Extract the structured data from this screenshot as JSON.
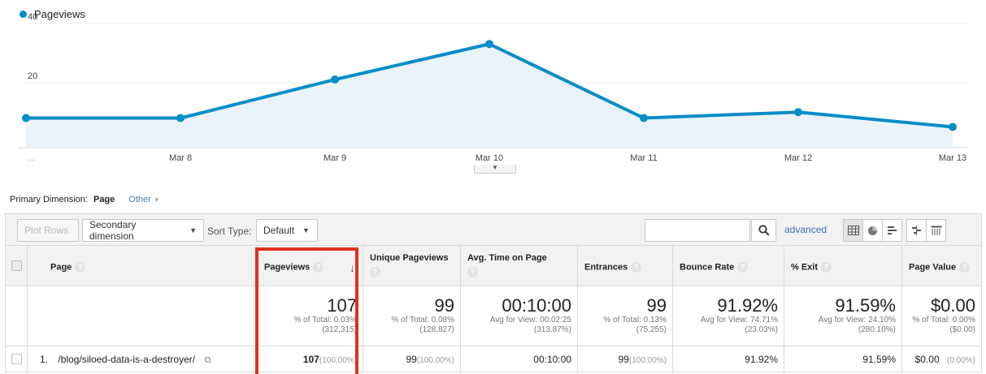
{
  "chart": {
    "legend": "Pageviews",
    "accent_color": "#058dc7",
    "toggle_icon": "chevron-down-icon"
  },
  "chart_data": {
    "type": "area",
    "title": "",
    "series": [
      {
        "name": "Pageviews",
        "values": [
          10,
          10,
          23,
          35,
          10,
          12,
          7
        ]
      }
    ],
    "x": [
      "…",
      "Mar 8",
      "Mar 9",
      "Mar 10",
      "Mar 11",
      "Mar 12",
      "Mar 13"
    ],
    "yticks": [
      20,
      40
    ],
    "ylim": [
      0,
      40
    ],
    "grid": true,
    "legend_position": "top-left"
  },
  "primary_dimension": {
    "label": "Primary Dimension:",
    "active": "Page",
    "other": "Other"
  },
  "toolbar": {
    "plot_rows": "Plot Rows",
    "secondary_dimension": "Secondary dimension",
    "sort_type_label": "Sort Type:",
    "sort_type_value": "Default",
    "search_placeholder": "",
    "advanced": "advanced"
  },
  "table": {
    "headers": {
      "page": "Page",
      "pageviews": "Pageviews",
      "unique_pageviews": "Unique Pageviews",
      "avg_time": "Avg. Time on Page",
      "entrances": "Entrances",
      "bounce_rate": "Bounce Rate",
      "exit": "% Exit",
      "page_value": "Page Value"
    },
    "totals": {
      "pageviews": {
        "big": "107",
        "sub1": "% of Total: 0.03%",
        "sub2": "(312,315)"
      },
      "unique_pageviews": {
        "big": "99",
        "sub1": "% of Total: 0.08%",
        "sub2": "(128,827)"
      },
      "avg_time": {
        "big": "00:10:00",
        "sub1": "Avg for View: 00:02:25",
        "sub2": "(313.87%)"
      },
      "entrances": {
        "big": "99",
        "sub1": "% of Total: 0.13%",
        "sub2": "(75,255)"
      },
      "bounce_rate": {
        "big": "91.92%",
        "sub1": "Avg for View: 74.71%",
        "sub2": "(23.03%)"
      },
      "exit": {
        "big": "91.59%",
        "sub1": "Avg for View: 24.10%",
        "sub2": "(280.10%)"
      },
      "page_value": {
        "big": "$0.00",
        "sub1": "% of Total: 0.00%",
        "sub2": "($0.00)"
      }
    },
    "rows": [
      {
        "index": "1.",
        "page": "/blog/siloed-data-is-a-destroyer/",
        "pageviews": "107",
        "pageviews_pct": "(100.00%)",
        "unique_pageviews": "99",
        "unique_pageviews_pct": "(100.00%)",
        "avg_time": "00:10:00",
        "entrances": "99",
        "entrances_pct": "(100.00%)",
        "bounce_rate": "91.92%",
        "exit": "91.59%",
        "page_value": "$0.00",
        "page_value_pct": "(0.00%)"
      }
    ]
  },
  "highlight_color": "#e3301e"
}
